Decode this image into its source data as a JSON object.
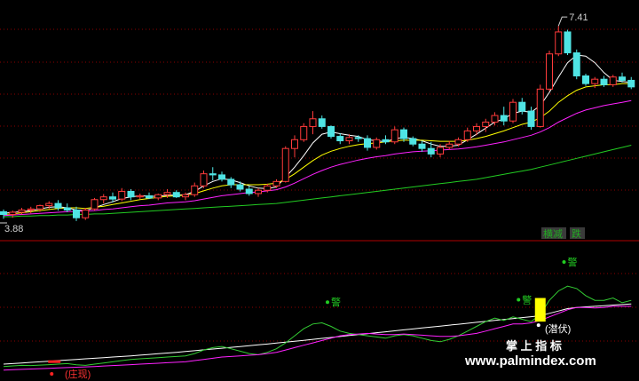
{
  "colors": {
    "background": "#000000",
    "grid": "#8b0000",
    "separator": "#b00000",
    "candle_up": "#ff3b3b",
    "candle_down": "#4fe4e4",
    "ma_white": "#ffffff",
    "ma_yellow": "#ffff00",
    "ma_magenta": "#ff22ff",
    "ma_green": "#22cc22",
    "warn": "#22cc22",
    "signal_bar": "#ffff00",
    "indicator_white": "#ffffff",
    "indicator_green": "#33cc33",
    "indicator_magenta": "#ff22ff",
    "text_grey": "#cfcfcf",
    "red_dot": "#ff2222",
    "badge_green": "#22aa22",
    "badge_bg": "#3a3a3a"
  },
  "price_panel": {
    "high_label": "7.41",
    "low_label": "3.88"
  },
  "status_badges": {
    "label_a": "横减",
    "label_b": "跌"
  },
  "indicator_panel": {
    "warn_char": "警",
    "left_tag": "(庄现)",
    "right_tag": "(潜伏)"
  },
  "watermark": {
    "cn": "掌 上 指 标",
    "url": "www.palmindex.com"
  },
  "chart_data": [
    {
      "type": "candlestick",
      "panel": "price",
      "ylim": [
        3.6,
        7.8
      ],
      "y_labels": [
        "7.41",
        "3.88"
      ],
      "candles": [
        [
          4.03,
          4.07,
          3.9,
          3.98
        ],
        [
          3.98,
          4.05,
          3.92,
          4.02
        ],
        [
          4.02,
          4.1,
          3.98,
          4.06
        ],
        [
          4.06,
          4.12,
          4.0,
          4.08
        ],
        [
          4.08,
          4.16,
          4.03,
          4.14
        ],
        [
          4.14,
          4.22,
          4.08,
          4.18
        ],
        [
          4.18,
          4.24,
          4.05,
          4.1
        ],
        [
          4.1,
          4.18,
          4.02,
          4.06
        ],
        [
          4.06,
          4.12,
          3.86,
          3.92
        ],
        [
          3.92,
          4.1,
          3.88,
          4.06
        ],
        [
          4.08,
          4.28,
          4.05,
          4.25
        ],
        [
          4.25,
          4.35,
          4.18,
          4.3
        ],
        [
          4.3,
          4.38,
          4.2,
          4.26
        ],
        [
          4.26,
          4.46,
          4.22,
          4.4
        ],
        [
          4.4,
          4.44,
          4.24,
          4.3
        ],
        [
          4.3,
          4.36,
          4.26,
          4.32
        ],
        [
          4.32,
          4.38,
          4.26,
          4.28
        ],
        [
          4.28,
          4.36,
          4.24,
          4.34
        ],
        [
          4.34,
          4.44,
          4.28,
          4.38
        ],
        [
          4.38,
          4.42,
          4.28,
          4.3
        ],
        [
          4.3,
          4.38,
          4.24,
          4.34
        ],
        [
          4.34,
          4.56,
          4.3,
          4.5
        ],
        [
          4.5,
          4.78,
          4.46,
          4.72
        ],
        [
          4.72,
          4.84,
          4.6,
          4.7
        ],
        [
          4.7,
          4.76,
          4.58,
          4.62
        ],
        [
          4.62,
          4.66,
          4.46,
          4.52
        ],
        [
          4.52,
          4.58,
          4.4,
          4.44
        ],
        [
          4.44,
          4.5,
          4.32,
          4.36
        ],
        [
          4.36,
          4.46,
          4.3,
          4.42
        ],
        [
          4.42,
          4.54,
          4.38,
          4.5
        ],
        [
          4.5,
          4.62,
          4.46,
          4.58
        ],
        [
          4.58,
          5.22,
          4.56,
          5.18
        ],
        [
          5.18,
          5.42,
          5.02,
          5.34
        ],
        [
          5.34,
          5.64,
          5.3,
          5.58
        ],
        [
          5.58,
          5.86,
          5.44,
          5.72
        ],
        [
          5.72,
          5.78,
          5.54,
          5.58
        ],
        [
          5.58,
          5.6,
          5.36,
          5.4
        ],
        [
          5.4,
          5.46,
          5.26,
          5.32
        ],
        [
          5.32,
          5.44,
          5.26,
          5.38
        ],
        [
          5.38,
          5.42,
          5.3,
          5.36
        ],
        [
          5.36,
          5.42,
          5.14,
          5.2
        ],
        [
          5.2,
          5.38,
          5.16,
          5.34
        ],
        [
          5.34,
          5.42,
          5.26,
          5.3
        ],
        [
          5.3,
          5.58,
          5.26,
          5.52
        ],
        [
          5.52,
          5.56,
          5.3,
          5.36
        ],
        [
          5.36,
          5.4,
          5.22,
          5.26
        ],
        [
          5.26,
          5.32,
          5.12,
          5.18
        ],
        [
          5.18,
          5.3,
          5.02,
          5.08
        ],
        [
          5.08,
          5.26,
          5.02,
          5.2
        ],
        [
          5.2,
          5.32,
          5.16,
          5.26
        ],
        [
          5.26,
          5.38,
          5.22,
          5.34
        ],
        [
          5.34,
          5.56,
          5.3,
          5.5
        ],
        [
          5.5,
          5.64,
          5.42,
          5.58
        ],
        [
          5.58,
          5.72,
          5.48,
          5.66
        ],
        [
          5.66,
          5.84,
          5.6,
          5.78
        ],
        [
          5.78,
          5.94,
          5.6,
          5.68
        ],
        [
          5.68,
          6.08,
          5.64,
          6.02
        ],
        [
          6.02,
          6.1,
          5.8,
          5.86
        ],
        [
          5.86,
          5.94,
          5.52,
          5.58
        ],
        [
          5.58,
          6.34,
          5.56,
          6.26
        ],
        [
          6.26,
          6.96,
          6.22,
          6.9
        ],
        [
          6.9,
          7.41,
          6.86,
          7.3
        ],
        [
          7.3,
          7.34,
          6.88,
          6.92
        ],
        [
          6.92,
          6.98,
          6.44,
          6.5
        ],
        [
          6.5,
          6.54,
          6.32,
          6.36
        ],
        [
          6.36,
          6.48,
          6.28,
          6.44
        ],
        [
          6.44,
          6.5,
          6.3,
          6.34
        ],
        [
          6.34,
          6.52,
          6.3,
          6.48
        ],
        [
          6.48,
          6.56,
          6.38,
          6.42
        ],
        [
          6.42,
          6.48,
          6.26,
          6.3
        ]
      ],
      "ma_lines": [
        {
          "color_key": "ma_white",
          "values": [
            4.0,
            4.02,
            4.03,
            4.05,
            4.08,
            4.11,
            4.12,
            4.1,
            4.06,
            4.05,
            4.1,
            4.16,
            4.21,
            4.27,
            4.3,
            4.32,
            4.31,
            4.31,
            4.33,
            4.33,
            4.34,
            4.4,
            4.5,
            4.58,
            4.63,
            4.61,
            4.56,
            4.5,
            4.46,
            4.45,
            4.48,
            4.66,
            4.84,
            5.05,
            5.28,
            5.44,
            5.48,
            5.45,
            5.42,
            5.4,
            5.34,
            5.32,
            5.3,
            5.36,
            5.38,
            5.36,
            5.32,
            5.26,
            5.22,
            5.22,
            5.24,
            5.34,
            5.44,
            5.55,
            5.66,
            5.72,
            5.82,
            5.86,
            5.84,
            5.96,
            6.2,
            6.48,
            6.74,
            6.88,
            6.86,
            6.74,
            6.56,
            6.42,
            6.4,
            6.38
          ]
        },
        {
          "color_key": "ma_yellow",
          "values": [
            3.98,
            3.99,
            4.01,
            4.03,
            4.05,
            4.07,
            4.09,
            4.1,
            4.1,
            4.09,
            4.11,
            4.13,
            4.16,
            4.19,
            4.22,
            4.25,
            4.27,
            4.29,
            4.31,
            4.32,
            4.33,
            4.36,
            4.41,
            4.46,
            4.5,
            4.52,
            4.52,
            4.52,
            4.52,
            4.53,
            4.55,
            4.62,
            4.72,
            4.84,
            4.96,
            5.06,
            5.13,
            5.18,
            5.22,
            5.25,
            5.27,
            5.28,
            5.3,
            5.32,
            5.33,
            5.33,
            5.33,
            5.32,
            5.31,
            5.31,
            5.31,
            5.33,
            5.36,
            5.4,
            5.45,
            5.5,
            5.56,
            5.62,
            5.66,
            5.74,
            5.86,
            6.02,
            6.14,
            6.24,
            6.3,
            6.32,
            6.34,
            6.34,
            6.36,
            6.36
          ]
        },
        {
          "color_key": "ma_magenta",
          "values": [
            3.96,
            3.97,
            3.98,
            3.99,
            4.0,
            4.01,
            4.02,
            4.03,
            4.04,
            4.04,
            4.05,
            4.07,
            4.08,
            4.1,
            4.12,
            4.14,
            4.15,
            4.17,
            4.19,
            4.2,
            4.21,
            4.23,
            4.26,
            4.29,
            4.32,
            4.34,
            4.36,
            4.38,
            4.39,
            4.41,
            4.43,
            4.48,
            4.55,
            4.63,
            4.71,
            4.78,
            4.84,
            4.89,
            4.93,
            4.97,
            5.0,
            5.03,
            5.05,
            5.08,
            5.1,
            5.12,
            5.13,
            5.14,
            5.15,
            5.16,
            5.17,
            5.19,
            5.21,
            5.24,
            5.27,
            5.3,
            5.34,
            5.38,
            5.42,
            5.48,
            5.56,
            5.66,
            5.74,
            5.82,
            5.88,
            5.92,
            5.96,
            5.99,
            6.02,
            6.05
          ]
        },
        {
          "color_key": "ma_green",
          "values": [
            3.94,
            3.94,
            3.95,
            3.95,
            3.96,
            3.96,
            3.97,
            3.97,
            3.98,
            3.98,
            3.99,
            3.99,
            4.0,
            4.01,
            4.02,
            4.03,
            4.04,
            4.05,
            4.06,
            4.07,
            4.08,
            4.09,
            4.1,
            4.11,
            4.12,
            4.13,
            4.14,
            4.15,
            4.16,
            4.17,
            4.18,
            4.2,
            4.22,
            4.24,
            4.26,
            4.28,
            4.3,
            4.32,
            4.34,
            4.36,
            4.38,
            4.4,
            4.42,
            4.44,
            4.46,
            4.48,
            4.5,
            4.52,
            4.54,
            4.56,
            4.58,
            4.6,
            4.62,
            4.65,
            4.68,
            4.71,
            4.74,
            4.77,
            4.8,
            4.84,
            4.88,
            4.92,
            4.96,
            5.0,
            5.04,
            5.08,
            5.12,
            5.16,
            5.2,
            5.24
          ]
        }
      ]
    },
    {
      "type": "line",
      "panel": "indicator",
      "ylim": [
        0,
        100
      ],
      "series": [
        {
          "color_key": "indicator_white",
          "values": [
            6,
            6.5,
            7,
            7.5,
            8,
            8.5,
            9,
            9.5,
            10,
            10.5,
            11,
            11.5,
            12,
            12.5,
            13,
            13.6,
            14.2,
            14.8,
            15.4,
            16,
            16.7,
            17.4,
            18.1,
            18.8,
            19.5,
            20.2,
            20.9,
            21.6,
            22.3,
            23,
            23.8,
            24.6,
            25.4,
            26.2,
            27,
            27.8,
            28.6,
            29.4,
            30.2,
            31,
            31.8,
            32.6,
            33.4,
            34.2,
            35,
            35.8,
            36.6,
            37.4,
            38.2,
            39,
            39.8,
            40.6,
            41.4,
            42.2,
            43,
            43.8,
            44.6,
            45.4,
            46.2,
            47,
            49,
            51,
            53,
            54,
            54.5,
            55,
            55.5,
            56,
            56.5,
            57
          ]
        },
        {
          "color_key": "indicator_green",
          "values": [
            4,
            4.5,
            5,
            4.8,
            5.2,
            5.6,
            6,
            6.5,
            5.5,
            5,
            6,
            7,
            8,
            9,
            10,
            10.5,
            11,
            11.5,
            12,
            12.5,
            13,
            15,
            18,
            20,
            21,
            19,
            17,
            15,
            14,
            16,
            19,
            24,
            30,
            36,
            40,
            41,
            38,
            34,
            32,
            31,
            30,
            29,
            28,
            30,
            31,
            30,
            28,
            26,
            25,
            27,
            30,
            34,
            38,
            42,
            45,
            43,
            46,
            44,
            42,
            48,
            60,
            68,
            72,
            70,
            64,
            60,
            60,
            62,
            58,
            60
          ]
        },
        {
          "color_key": "indicator_magenta",
          "values": [
            1,
            1.3,
            1.6,
            1.9,
            2.2,
            2.5,
            2.8,
            3.1,
            3.4,
            3.7,
            4,
            4.4,
            4.8,
            5.2,
            5.6,
            6,
            6.4,
            6.8,
            7.2,
            7.6,
            8,
            9,
            10,
            11,
            12,
            12.5,
            13,
            13.5,
            14,
            15,
            16,
            18,
            20,
            22,
            24,
            26,
            28,
            30,
            31,
            31.5,
            32,
            31.5,
            31,
            31,
            31.5,
            31,
            30.5,
            30,
            29.5,
            29.5,
            30,
            31,
            32,
            34,
            36,
            38,
            40,
            40,
            41,
            43,
            46,
            49,
            52,
            54,
            54,
            53.5,
            54,
            55,
            55,
            55
          ]
        }
      ],
      "signal_bar": {
        "index": 59,
        "from": 42,
        "to": 62
      },
      "red_marker_index": 5,
      "warn_markers": [
        {
          "index": 36,
          "value": 57
        },
        {
          "index": 57,
          "value": 59
        },
        {
          "index": 62,
          "value": 91
        }
      ]
    }
  ]
}
